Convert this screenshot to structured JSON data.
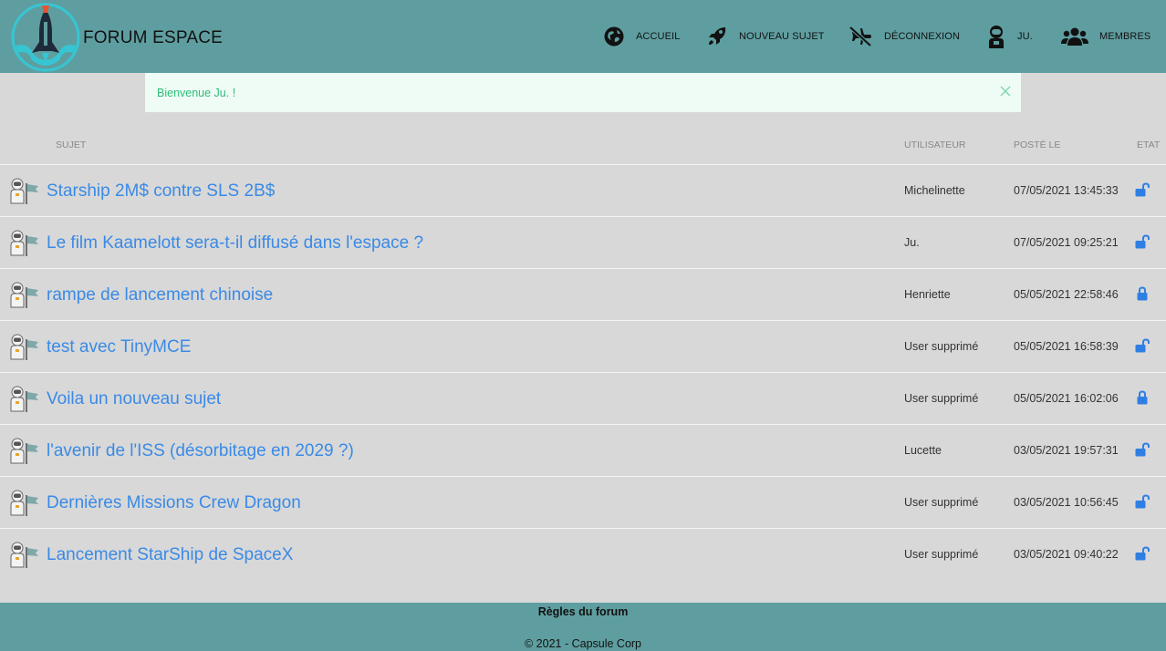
{
  "header": {
    "title": "FORUM ESPACE",
    "nav": [
      {
        "label": "ACCUEIL",
        "icon": "globe-icon"
      },
      {
        "label": "NOUVEAU SUJET",
        "icon": "rocket-icon"
      },
      {
        "label": "DÉCONNEXION",
        "icon": "plane-slash-icon"
      },
      {
        "label": "JU.",
        "icon": "astronaut-icon"
      },
      {
        "label": "MEMBRES",
        "icon": "users-icon"
      }
    ]
  },
  "alert": {
    "message": "Bienvenue Ju. !"
  },
  "table": {
    "headers": {
      "subject": "SUJET",
      "user": "UTILISATEUR",
      "posted": "POSTÉ LE",
      "state": "ETAT"
    },
    "rows": [
      {
        "title": "Starship 2M$ contre SLS 2B$",
        "user": "Michelinette",
        "date": "07/05/2021 13:45:33",
        "state": "unlocked"
      },
      {
        "title": "Le film Kaamelott sera-t-il diffusé dans l'espace ?",
        "user": "Ju.",
        "date": "07/05/2021 09:25:21",
        "state": "unlocked"
      },
      {
        "title": "rampe de lancement chinoise",
        "user": "Henriette",
        "date": "05/05/2021 22:58:46",
        "state": "locked"
      },
      {
        "title": "test avec TinyMCE",
        "user": "User supprimé",
        "date": "05/05/2021 16:58:39",
        "state": "unlocked"
      },
      {
        "title": "Voila un nouveau sujet",
        "user": "User supprimé",
        "date": "05/05/2021 16:02:06",
        "state": "locked"
      },
      {
        "title": "l'avenir de l'ISS (désorbitage en 2029 ?)",
        "user": "Lucette",
        "date": "03/05/2021 19:57:31",
        "state": "unlocked"
      },
      {
        "title": "Dernières Missions Crew Dragon",
        "user": "User supprimé",
        "date": "03/05/2021 10:56:45",
        "state": "unlocked"
      },
      {
        "title": "Lancement StarShip de SpaceX",
        "user": "User supprimé",
        "date": "03/05/2021 09:40:22",
        "state": "unlocked"
      }
    ]
  },
  "footer": {
    "rules": "Règles du forum",
    "copyright": "© 2021 - Capsule Corp"
  },
  "colors": {
    "header": "#5f9ea0",
    "link": "#3a8ae6",
    "alert_text": "#2dbd79",
    "alert_bg": "#effbf5",
    "background": "#d8d8d8"
  }
}
